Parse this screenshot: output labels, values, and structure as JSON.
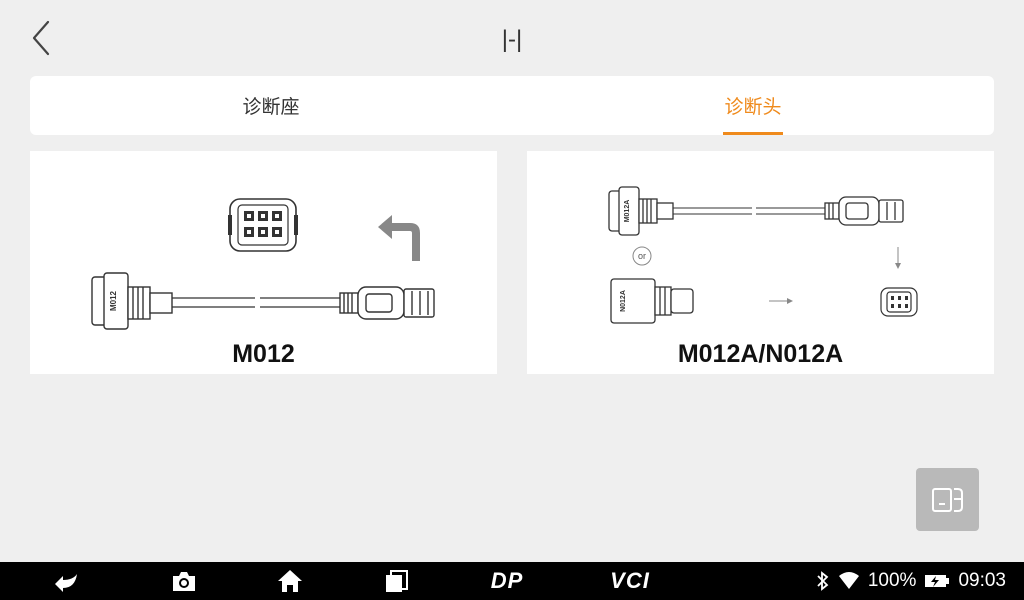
{
  "header": {
    "title": "|-|"
  },
  "tabs": [
    {
      "label": "诊断座",
      "active": false
    },
    {
      "label": "诊断头",
      "active": true
    }
  ],
  "cards": [
    {
      "label": "M012",
      "cable_tag": "M012"
    },
    {
      "label": "M012A/N012A",
      "cable_tag_top": "M012A",
      "cable_tag_bottom": "N012A",
      "or_text": "or"
    }
  ],
  "colors": {
    "accent": "#ef8a1c",
    "float_button": "#b9b9b9",
    "navbar": "#000000"
  },
  "navbar": {
    "icons": [
      "back-arrow-icon",
      "camera-icon",
      "home-icon",
      "recent-apps-icon"
    ],
    "dp_label": "DP",
    "vci_label": "VCI",
    "battery_text": "100%",
    "time": "09:03"
  }
}
